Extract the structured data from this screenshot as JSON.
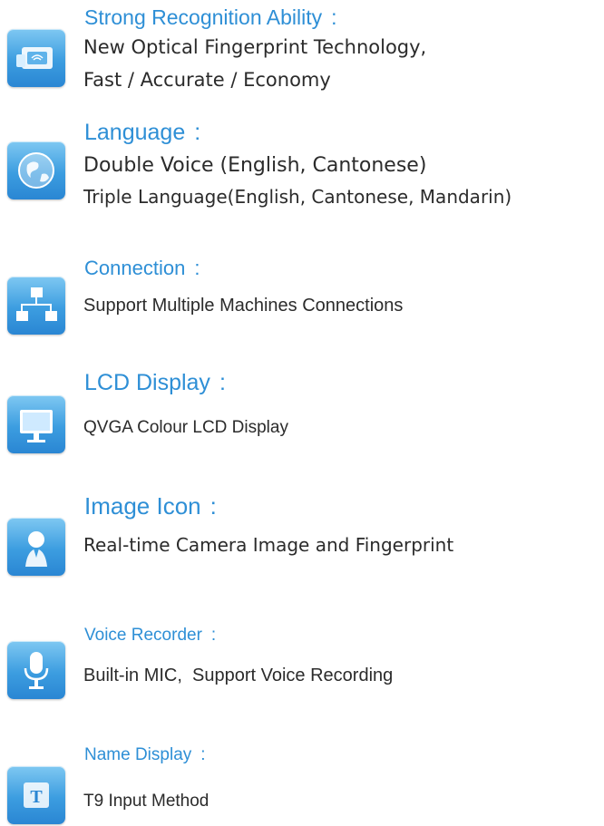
{
  "features": [
    {
      "title": "Strong Recognition Ability",
      "colon": ":",
      "lines": [
        "New Optical Fingerprint Technology,",
        "Fast / Accurate / Economy"
      ],
      "icon": "fingerprint-scanner-icon"
    },
    {
      "title": "Language",
      "colon": ":",
      "lines": [
        "Double Voice (English, Cantonese)",
        "Triple Language(English, Cantonese, Mandarin)"
      ],
      "icon": "globe-icon"
    },
    {
      "title": "Connection",
      "colon": ":",
      "lines": [
        "Support Multiple Machines Connections"
      ],
      "icon": "network-icon"
    },
    {
      "title": "LCD Display",
      "colon": ":",
      "lines": [
        "QVGA Colour LCD Display"
      ],
      "icon": "monitor-icon"
    },
    {
      "title": "Image Icon",
      "colon": ":",
      "lines": [
        "Real-time Camera Image and Fingerprint"
      ],
      "icon": "person-icon"
    },
    {
      "title": "Voice Recorder",
      "colon": ":",
      "lines": [
        "Built-in MIC,  Support Voice Recording"
      ],
      "icon": "microphone-icon"
    },
    {
      "title": "Name Display",
      "colon": ":",
      "lines": [
        "T9 Input Method"
      ],
      "icon": "text-t-icon"
    }
  ],
  "colors": {
    "title": "#2e8fd6",
    "text": "#2b2b2b",
    "icon_bg": "#3c9de0"
  }
}
